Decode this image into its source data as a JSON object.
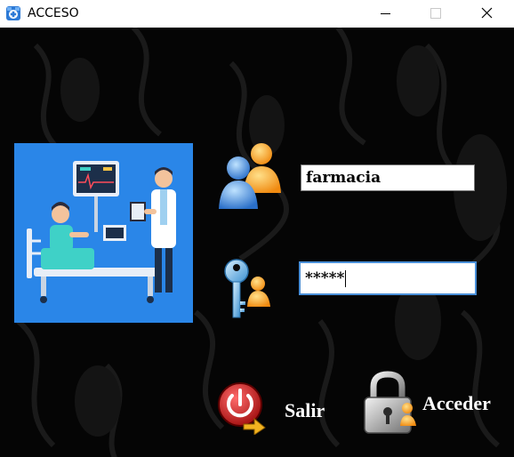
{
  "window": {
    "title": "ACCESO"
  },
  "login": {
    "username_value": "farmacia",
    "password_masked": "*****"
  },
  "actions": {
    "exit_label": "Salir",
    "login_label": "Acceder"
  },
  "icons": {
    "app": "medical-cross-icon",
    "users": "users-icon",
    "password": "key-user-icon",
    "exit": "power-icon",
    "login": "padlock-icon"
  },
  "colors": {
    "background": "#000000",
    "image_bg": "#2a86e8",
    "focus_border": "#4a90d9"
  }
}
